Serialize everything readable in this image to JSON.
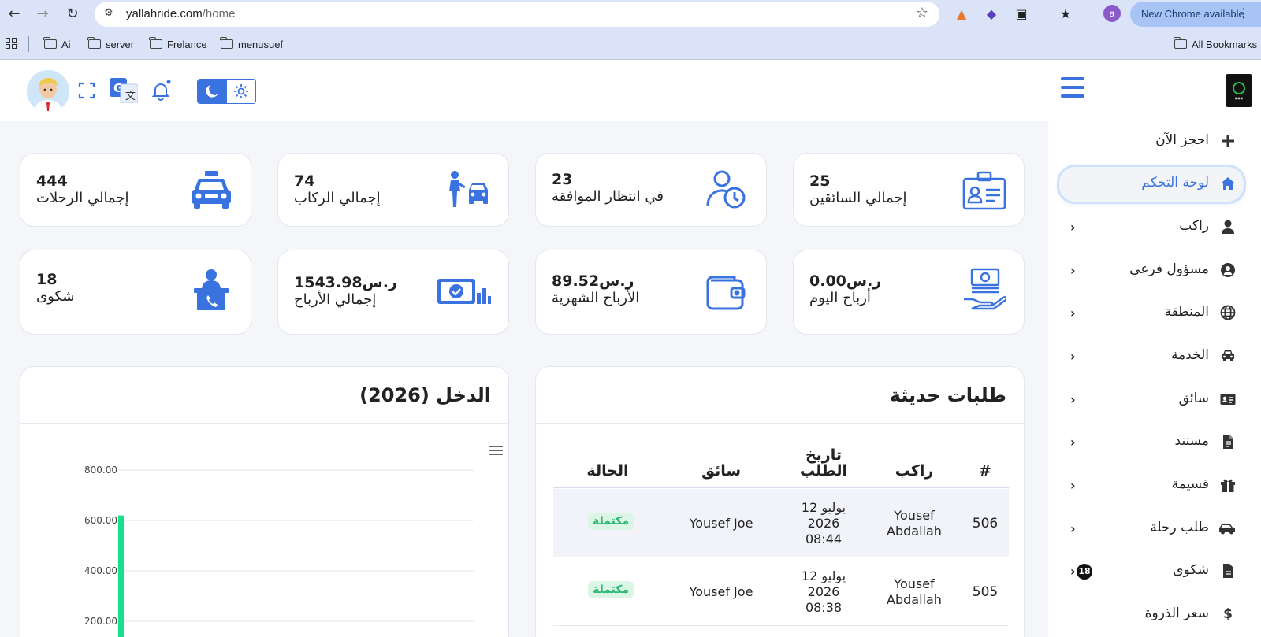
{
  "browser": {
    "url_host": "yallahride.com",
    "url_path": "/home",
    "profile_initial": "a",
    "update_label": "New Chrome available",
    "bookmarks": [
      "Ai",
      "server",
      "Frelance",
      "menusuef"
    ],
    "all_bookmarks": "All Bookmarks"
  },
  "colors": {
    "accent": "#3a73e0",
    "success": "#2bb673",
    "chart_bar": "#16e08a"
  },
  "stats": [
    {
      "value": "444",
      "label": "إجمالي الرحلات",
      "icon": "taxi-icon"
    },
    {
      "value": "74",
      "label": "إجمالي الركاب",
      "icon": "rider-taxi-icon"
    },
    {
      "value": "23",
      "label": "في انتظار الموافقة",
      "icon": "user-clock-icon"
    },
    {
      "value": "25",
      "label": "إجمالي السائقين",
      "icon": "id-card-icon"
    },
    {
      "value": "18",
      "label": "شكوى",
      "icon": "support-desk-icon"
    },
    {
      "value": "1543.98ر.س",
      "label": "إجمالي الأرباح",
      "icon": "cash-chart-icon"
    },
    {
      "value": "89.52ر.س",
      "label": "الأرباح الشهرية",
      "icon": "wallet-icon"
    },
    {
      "value": "0.00ر.س",
      "label": "أرباح اليوم",
      "icon": "money-hand-icon"
    }
  ],
  "recent": {
    "title": "طلبات حديثة",
    "headers": {
      "id": "#",
      "rider": "راكب",
      "date": "تاريخ الطلب",
      "driver": "سائق",
      "status": "الحالة"
    },
    "rows": [
      {
        "id": "506",
        "rider": "Yousef Abdallah",
        "date": "12 يوليو 2026 08:44",
        "driver": "Yousef Joe",
        "status": "مكتملة"
      },
      {
        "id": "505",
        "rider": "Yousef Abdallah",
        "date": "12 يوليو 2026 08:38",
        "driver": "Yousef Joe",
        "status": "مكتملة"
      }
    ]
  },
  "income": {
    "title": "الدخل (2026)"
  },
  "chart_data": {
    "type": "bar",
    "title": "الدخل (2026)",
    "yticks": [
      "200.00",
      "400.00",
      "600.00",
      "800.00"
    ],
    "ylim": [
      0,
      800
    ],
    "grid": true,
    "series": [
      {
        "values": [
          620
        ]
      }
    ]
  },
  "sidebar": {
    "items": [
      {
        "label": "احجز الآن",
        "icon": "plus-icon",
        "chevron": false
      },
      {
        "label": "لوحة التحكم",
        "icon": "home-icon",
        "chevron": false,
        "active": true
      },
      {
        "label": "راكب",
        "icon": "user-icon",
        "chevron": true
      },
      {
        "label": "مسؤول فرعي",
        "icon": "user-circle-icon",
        "chevron": true
      },
      {
        "label": "المنطقة",
        "icon": "globe-icon",
        "chevron": true
      },
      {
        "label": "الخدمة",
        "icon": "car-icon",
        "chevron": true
      },
      {
        "label": "سائق",
        "icon": "id-badge-icon",
        "chevron": true
      },
      {
        "label": "مستند",
        "icon": "document-icon",
        "chevron": true
      },
      {
        "label": "قسيمة",
        "icon": "gift-icon",
        "chevron": true
      },
      {
        "label": "طلب رحلة",
        "icon": "car-side-icon",
        "chevron": true
      },
      {
        "label": "شكوى",
        "icon": "file-icon",
        "chevron": true,
        "badge": "18"
      },
      {
        "label": "سعر الذروة",
        "icon": "dollar-icon",
        "chevron": false
      }
    ]
  }
}
